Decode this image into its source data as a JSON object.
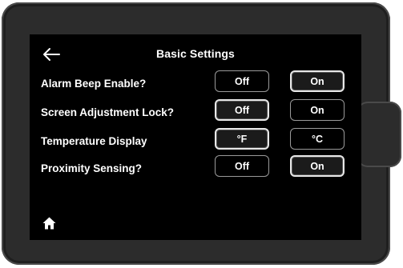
{
  "header": {
    "title": "Basic Settings",
    "back_icon": "back-arrow-icon"
  },
  "rows": [
    {
      "label": "Alarm Beep Enable?",
      "options": [
        "Off",
        "On"
      ],
      "selected": 1
    },
    {
      "label": "Screen Adjustment Lock?",
      "options": [
        "Off",
        "On"
      ],
      "selected": 0
    },
    {
      "label": "Temperature Display",
      "options": [
        "°F",
        "°C"
      ],
      "selected": 0
    },
    {
      "label": "Proximity Sensing?",
      "options": [
        "Off",
        "On"
      ],
      "selected": 1
    }
  ],
  "footer": {
    "home_icon": "home-icon"
  }
}
